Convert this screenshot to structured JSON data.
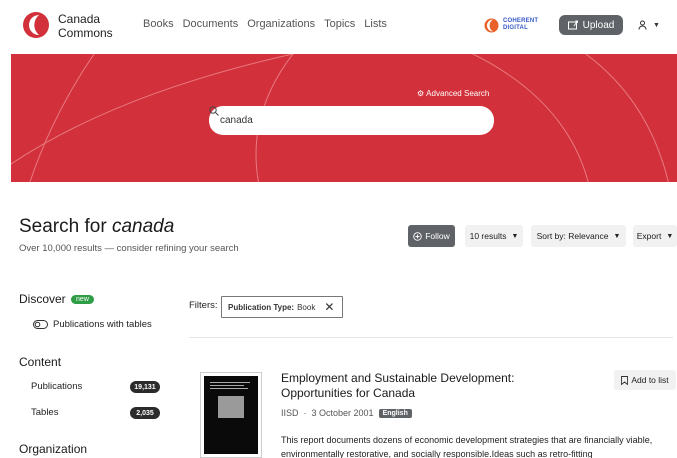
{
  "brand": {
    "name_line1": "Canada",
    "name_line2": "Commons"
  },
  "nav": [
    "Books",
    "Documents",
    "Organizations",
    "Topics",
    "Lists"
  ],
  "partner": {
    "line1": "COHERENT",
    "line2": "DIGITAL"
  },
  "upload_label": "Upload",
  "hero": {
    "advanced_search": "Advanced Search",
    "search_value": "canada",
    "bg_color": "#d2303a"
  },
  "results_header": {
    "title_prefix": "Search for",
    "query": "canada",
    "subtitle": "Over 10,000 results — consider refining your search",
    "follow_label": "Follow",
    "per_page_label": "10 results",
    "sort_label": "Sort by: Relevance",
    "export_label": "Export"
  },
  "sidebar": {
    "discover_heading": "Discover",
    "new_badge": "new",
    "publications_with_tables": "Publications with tables",
    "content_heading": "Content",
    "content_items": [
      {
        "label": "Publications",
        "count": "19,131"
      },
      {
        "label": "Tables",
        "count": "2,035"
      }
    ],
    "organization_heading": "Organization"
  },
  "filters": {
    "label": "Filters:",
    "chip_key": "Publication Type:",
    "chip_value": "Book"
  },
  "result": {
    "title": "Employment and Sustainable Development: Opportunities for Canada",
    "publisher": "IISD",
    "separator": "·",
    "date": "3 October 2001",
    "language": "English",
    "add_to_list": "Add to list",
    "description": "This report documents dozens of economic development strategies that are financially viable, environmentally restorative, and socially responsible.Ideas such as retro-fitting"
  },
  "colors": {
    "accent_red": "#d2303a",
    "dark_button": "#5f6266",
    "new_badge": "#2f9c46",
    "partner_blue": "#3559c7"
  },
  "icons": [
    "search-icon",
    "gear-icon",
    "upload-icon",
    "user-icon",
    "plus-circle-icon",
    "toggle-icon",
    "bookmark-icon",
    "close-icon",
    "caret-down-icon"
  ]
}
